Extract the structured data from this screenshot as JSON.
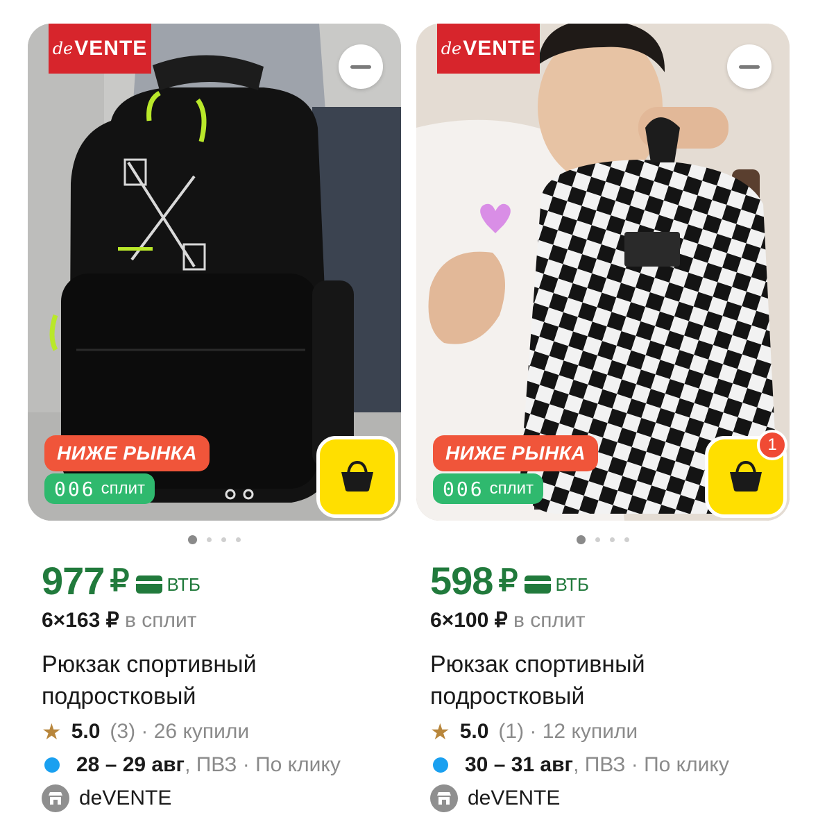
{
  "products": [
    {
      "brand_logo": "deVENTE",
      "brand_logo_parts": [
        "de",
        "VENTE"
      ],
      "badge_low": "НИЖЕ РЫНКА",
      "badge_split_num": "006",
      "badge_split_word": "сплит",
      "cart_count": "",
      "price": "977",
      "currency": "₽",
      "bank": "ВТБ",
      "split_amount": "6×163 ₽",
      "split_tail": "в сплит",
      "title": "Рюкзак спортивный подростковый",
      "rating": "5.0",
      "reviews": "(3)",
      "bought": "· 26 купили",
      "dates": "28 – 29 авг",
      "delivery_rest": ", ПВЗ · По клику",
      "shop": "deVENTE",
      "image_dots": 4,
      "active_dot": 1
    },
    {
      "brand_logo": "deVENTE",
      "brand_logo_parts": [
        "de",
        "VENTE"
      ],
      "badge_low": "НИЖЕ РЫНКА",
      "badge_split_num": "006",
      "badge_split_word": "сплит",
      "cart_count": "1",
      "price": "598",
      "currency": "₽",
      "bank": "ВТБ",
      "split_amount": "6×100 ₽",
      "split_tail": "в сплит",
      "title": "Рюкзак спортивный подростковый",
      "rating": "5.0",
      "reviews": "(1)",
      "bought": "· 12 купили",
      "dates": "30 – 31 авг",
      "delivery_rest": ", ПВЗ · По клику",
      "shop": "deVENTE",
      "image_dots": 4,
      "active_dot": 1
    }
  ],
  "colors": {
    "price_green": "#217a3c",
    "badge_orange": "#f0553a",
    "badge_green": "#2fb96e",
    "cart_yellow": "#ffdf00",
    "brand_red": "#d7252c",
    "delivery_blue": "#1aa0f0"
  },
  "icons": [
    "minus-icon",
    "basket-icon",
    "bank-card-icon",
    "star-icon",
    "shop-icon"
  ]
}
